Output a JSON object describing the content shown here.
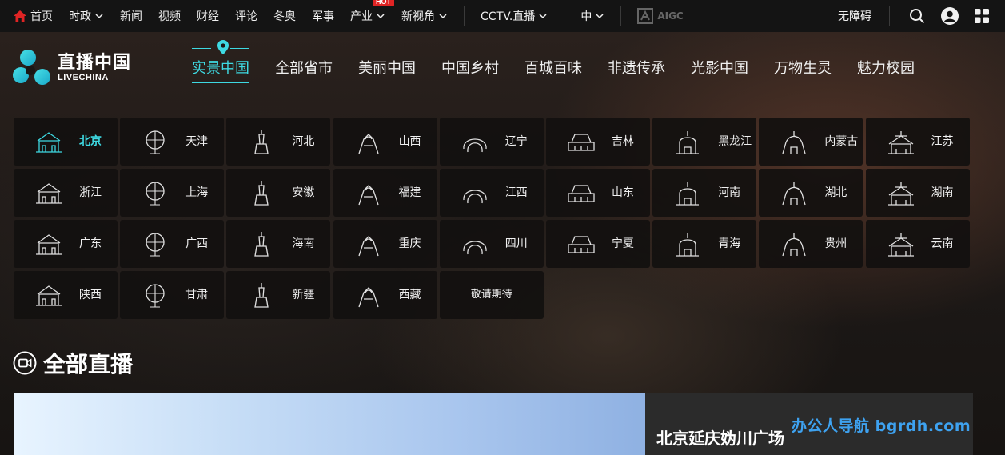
{
  "topbar": {
    "items": [
      {
        "label": "首页",
        "icon": "home-icon"
      },
      {
        "label": "时政",
        "dropdown": true
      },
      {
        "label": "新闻"
      },
      {
        "label": "视频"
      },
      {
        "label": "财经"
      },
      {
        "label": "评论"
      },
      {
        "label": "冬奥"
      },
      {
        "label": "军事"
      },
      {
        "label": "产业",
        "dropdown": true,
        "badge": "HOT"
      },
      {
        "label": "新视角",
        "dropdown": true
      }
    ],
    "cctv": "CCTV.直播",
    "lang": "中",
    "aigc": "AIGC",
    "accessibility": "无障碍",
    "accent_color": "#e02424"
  },
  "header": {
    "logo_cn": "直播中国",
    "logo_en": "LIVECHINA",
    "tabs": [
      "实景中国",
      "全部省市",
      "美丽中国",
      "中国乡村",
      "百城百味",
      "非遗传承",
      "光影中国",
      "万物生灵",
      "魅力校园"
    ],
    "active_tab": "实景中国",
    "accent_color": "#3ed9e2"
  },
  "provinces": [
    "北京",
    "天津",
    "河北",
    "山西",
    "辽宁",
    "吉林",
    "黑龙江",
    "内蒙古",
    "江苏",
    "浙江",
    "上海",
    "安徽",
    "福建",
    "江西",
    "山东",
    "河南",
    "湖北",
    "湖南",
    "广东",
    "广西",
    "海南",
    "重庆",
    "四川",
    "宁夏",
    "青海",
    "贵州",
    "云南",
    "陕西",
    "甘肃",
    "新疆",
    "西藏"
  ],
  "coming_soon": "敬请期待",
  "section": {
    "title": "全部直播"
  },
  "featured": {
    "title": "北京延庆妫川广场"
  },
  "watermark": "办公人导航 bgrdh.com"
}
